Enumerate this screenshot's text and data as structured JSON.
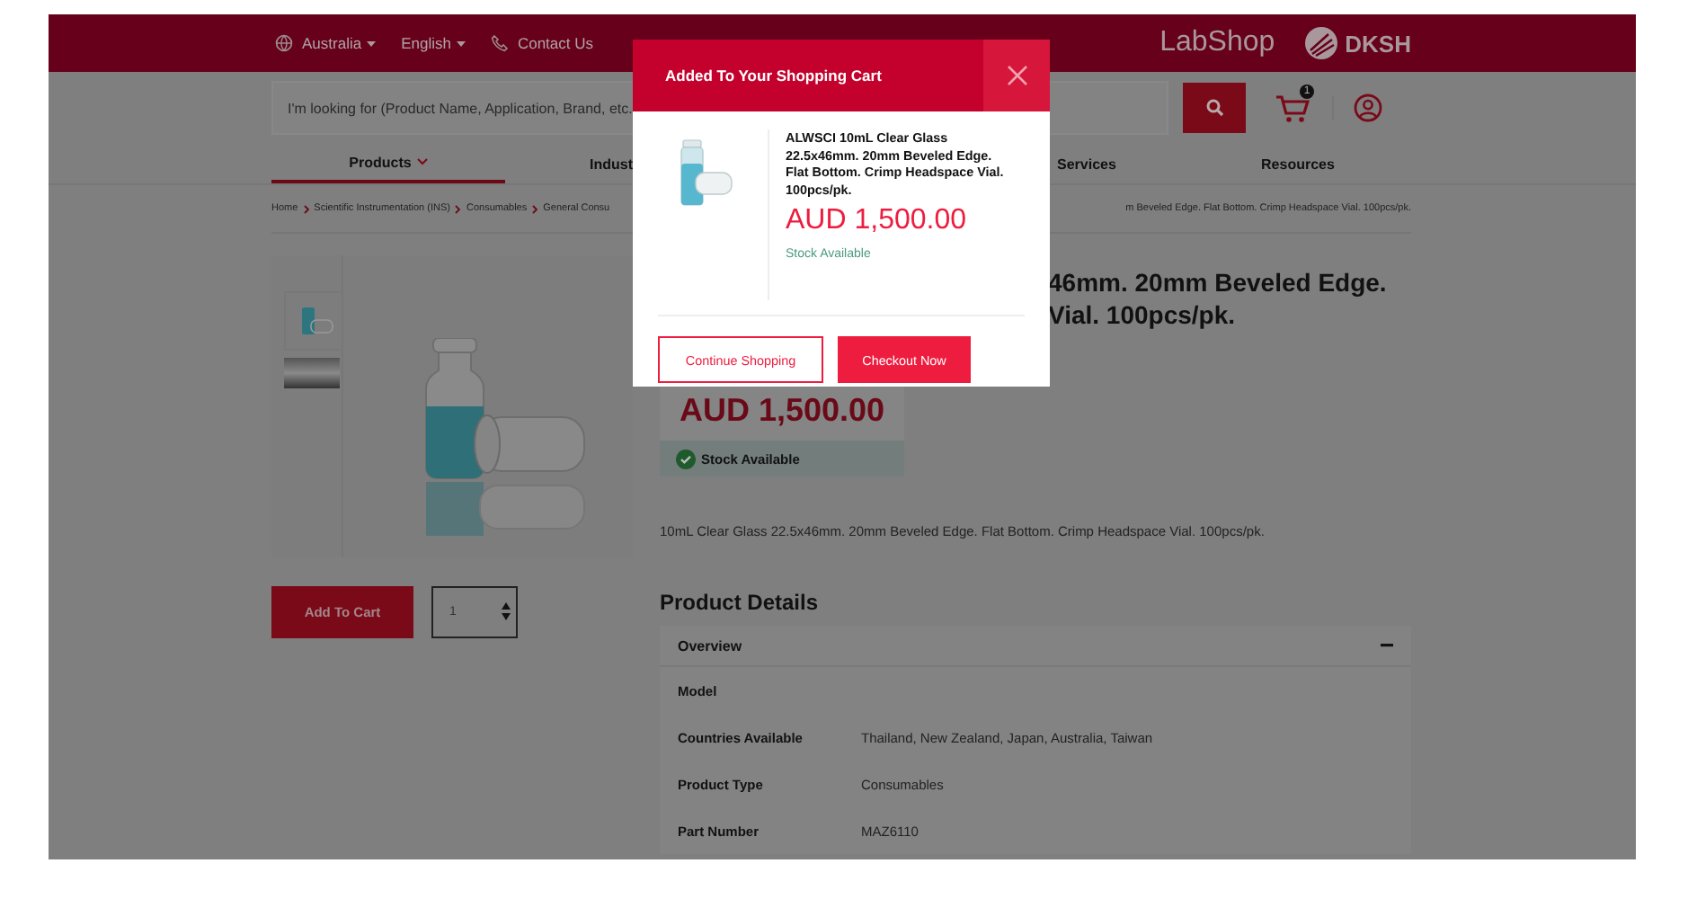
{
  "top_bar": {
    "region": "Australia",
    "language": "English",
    "contact": "Contact Us",
    "brand": "LabShop",
    "logo_text": "DKSH"
  },
  "search": {
    "placeholder": "I'm looking for (Product Name, Application, Brand, etc.",
    "cart_count": "1"
  },
  "nav": [
    {
      "label": "Products",
      "selected": true,
      "dropdown": true
    },
    {
      "label": "Indust",
      "selected": false,
      "dropdown": false
    },
    {
      "label": "Services",
      "selected": false,
      "dropdown": false
    },
    {
      "label": "Resources",
      "selected": false,
      "dropdown": false
    }
  ],
  "breadcrumb": {
    "before": [
      "Home",
      "Scientific Instrumentation (INS)",
      "Consumables",
      "General Consu"
    ],
    "after": "m Beveled Edge. Flat Bottom. Crimp Headspace Vial. 100pcs/pk."
  },
  "product": {
    "title_lines": [
      "46mm. 20mm Beveled Edge.",
      "Vial. 100pcs/pk."
    ],
    "price": "AUD 1,500.00",
    "stock": "Stock Available",
    "description": "10mL Clear Glass 22.5x46mm. 20mm Beveled Edge. Flat Bottom. Crimp Headspace Vial. 100pcs/pk.",
    "add_to_cart": "Add To Cart",
    "quantity": "1"
  },
  "details": {
    "heading": "Product Details",
    "section": "Overview",
    "expanded": true,
    "rows": [
      {
        "label": "Model"
      },
      {
        "label": "Countries Available",
        "value": "Thailand, New Zealand, Japan, Australia, Taiwan"
      },
      {
        "label": "Product Type",
        "value": "Consumables"
      },
      {
        "label": "Part Number",
        "value": "MAZ6110"
      }
    ]
  },
  "modal": {
    "title": "Added To Your Shopping Cart",
    "product_name": "ALWSCI 10mL Clear Glass 22.5x46mm. 20mm Beveled Edge. Flat Bottom. Crimp Headspace Vial. 100pcs/pk.",
    "price": "AUD 1,500.00",
    "stock": "Stock Available",
    "buttons": [
      {
        "label": "Continue Shopping",
        "kind": "outline"
      },
      {
        "label": "Checkout Now",
        "kind": "filled"
      }
    ]
  }
}
